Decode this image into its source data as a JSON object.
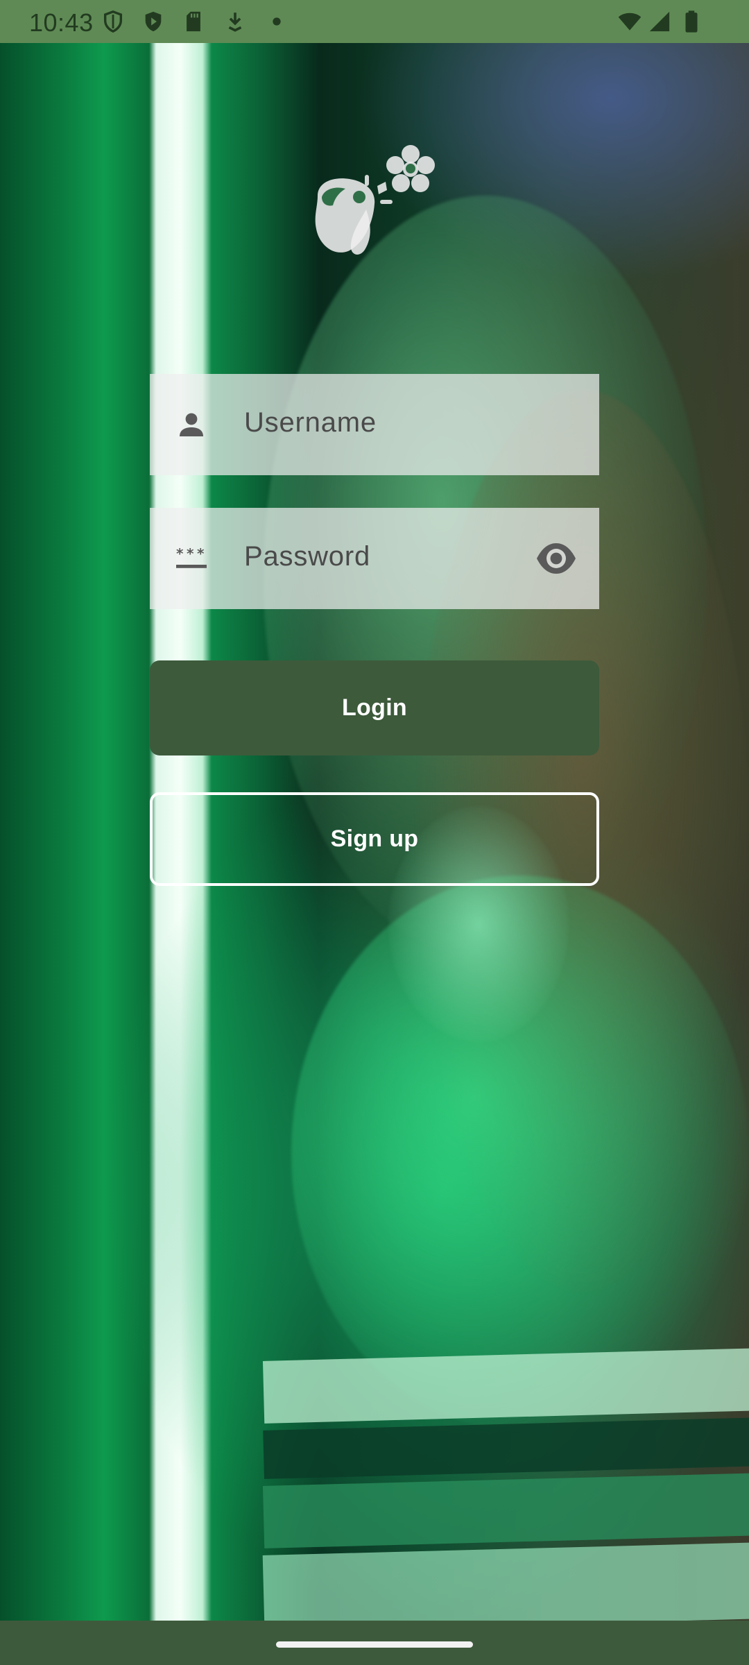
{
  "status_bar": {
    "time": "10:43",
    "left_icons": [
      "shield-outline-icon",
      "play-protect-icon",
      "sd-card-icon",
      "download-icon",
      "dot-icon"
    ],
    "right_icons": [
      "wifi-icon",
      "signal-icon",
      "battery-icon"
    ]
  },
  "logo": {
    "icon": "teapot-flower-icon"
  },
  "form": {
    "username": {
      "placeholder": "Username",
      "value": "",
      "icon": "person-icon"
    },
    "password": {
      "placeholder": "Password",
      "value": "",
      "icon": "password-dots-icon",
      "toggle_icon": "eye-icon"
    },
    "login_label": "Login",
    "signup_label": "Sign up"
  },
  "colors": {
    "status_bar": "#5f8a55",
    "nav_bar": "#3e5a3c",
    "login_button": "#3d5a3b",
    "field_background": "#eeeeee",
    "signup_border": "#ffffff"
  }
}
